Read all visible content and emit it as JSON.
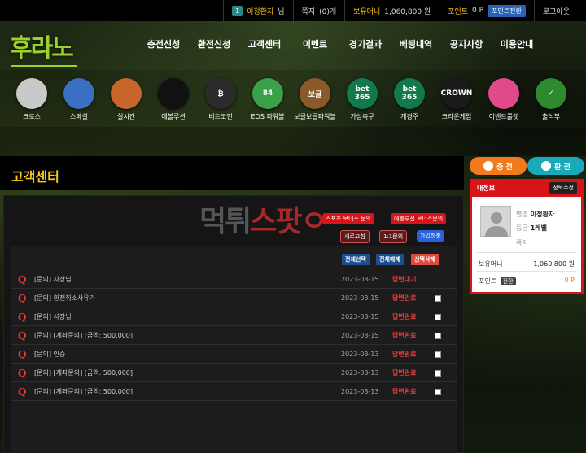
{
  "topbar": {
    "level_badge": "1",
    "user_name": "이정환자",
    "user_suffix": "님",
    "note_label": "쪽지",
    "note_count": "(0)개",
    "money_label": "보유머니",
    "money_value": "1,060,800 원",
    "point_label": "포인트",
    "point_value": "0 P",
    "point_convert": "포인트전환",
    "logout": "로그아웃"
  },
  "logo": "후라노",
  "nav": [
    "충전신청",
    "환전신청",
    "고객센터",
    "이벤트",
    "경기결과",
    "베팅내역",
    "공지사항",
    "이용안내"
  ],
  "games": [
    {
      "label": "크로스",
      "icon": "baseball-icon",
      "color": "#c9c9c9",
      "text": ""
    },
    {
      "label": "스페셜",
      "icon": "soccer-ball-icon",
      "color": "#3a6fc4",
      "text": ""
    },
    {
      "label": "실시간",
      "icon": "basketball-icon",
      "color": "#c6662a",
      "text": ""
    },
    {
      "label": "에볼루션",
      "icon": "evolution-icon",
      "color": "#111111",
      "text": ""
    },
    {
      "label": "비트코인",
      "icon": "bitcoin-icon",
      "color": "#2b2b2b",
      "text": "₿"
    },
    {
      "label": "EOS 파워볼",
      "icon": "powerball-84-icon",
      "color": "#3aa04a",
      "text": "84"
    },
    {
      "label": "보글보글파워볼",
      "icon": "bubble-powerball-icon",
      "color": "#8a5a2a",
      "text": "보글"
    },
    {
      "label": "가상축구",
      "icon": "bet365-icon",
      "color": "#127a4a",
      "text": "bet 365"
    },
    {
      "label": "개경주",
      "icon": "bet365-icon",
      "color": "#127a4a",
      "text": "bet 365"
    },
    {
      "label": "크라운게임",
      "icon": "crown-icon",
      "color": "#1a1a1a",
      "text": "CROWN"
    },
    {
      "label": "이벤트룰렛",
      "icon": "roulette-icon",
      "color": "#e04a8a",
      "text": ""
    },
    {
      "label": "출석부",
      "icon": "calendar-check-icon",
      "color": "#2e8a2e",
      "text": "✓"
    }
  ],
  "page_title": "고객센터",
  "watermark": {
    "part1": "먹튀",
    "part2": "스팟",
    "suffix": "ㅇ"
  },
  "quick_buttons": {
    "sports_bonus": "스포츠 보너스 문의",
    "evolution_bonus": "에볼루션 보너스문의",
    "refresh": "새로고침",
    "one_to_one": "1:1문의",
    "signup_greeting": "가입첫충"
  },
  "toolbar": {
    "select_all": "전체선택",
    "deselect_all": "전체해제",
    "delete_selected": "선택삭제"
  },
  "rows": [
    {
      "subject": "[문의] 사장님",
      "date": "2023-03-15",
      "status": "답변대기",
      "status_color": "#e63b3b",
      "checkbox": false
    },
    {
      "subject": "[문의] 환전취소사유가",
      "date": "2023-03-15",
      "status": "답변완료",
      "status_color": "#e63b3b",
      "checkbox": true
    },
    {
      "subject": "[문의] 사장님",
      "date": "2023-03-15",
      "status": "답변완료",
      "status_color": "#e63b3b",
      "checkbox": true
    },
    {
      "subject": "[문의] [계좌문의] [금액: 500,000]",
      "date": "2023-03-15",
      "status": "답변완료",
      "status_color": "#e63b3b",
      "checkbox": true
    },
    {
      "subject": "[문의] 인증",
      "date": "2023-03-13",
      "status": "답변완료",
      "status_color": "#e63b3b",
      "checkbox": true
    },
    {
      "subject": "[문의] [계좌문의] [금액: 500,000]",
      "date": "2023-03-13",
      "status": "답변완료",
      "status_color": "#e63b3b",
      "checkbox": true
    },
    {
      "subject": "[문의] [계좌문의] [금액: 500,000]",
      "date": "2023-03-13",
      "status": "답변완료",
      "status_color": "#e63b3b",
      "checkbox": true
    }
  ],
  "side": {
    "charge_tab": "충 전",
    "exchange_tab": "환 전",
    "info_title": "내정보",
    "edit_info": "정보수정",
    "nickname_label": "별명",
    "nickname": "이정환자",
    "grade_label": "등급",
    "grade": "1레벨",
    "note_label": "쪽지",
    "money_label": "보유머니",
    "money_value": "1,060,800 원",
    "point_label": "포인트",
    "point_convert": "전환",
    "point_value": "0 P"
  },
  "colors": {
    "accent_yellow": "#f5c518",
    "accent_red": "#d8141a",
    "charge_orange": "#f07a1c",
    "exchange_teal": "#1aa9b8",
    "logo_green": "#9ad12b"
  }
}
